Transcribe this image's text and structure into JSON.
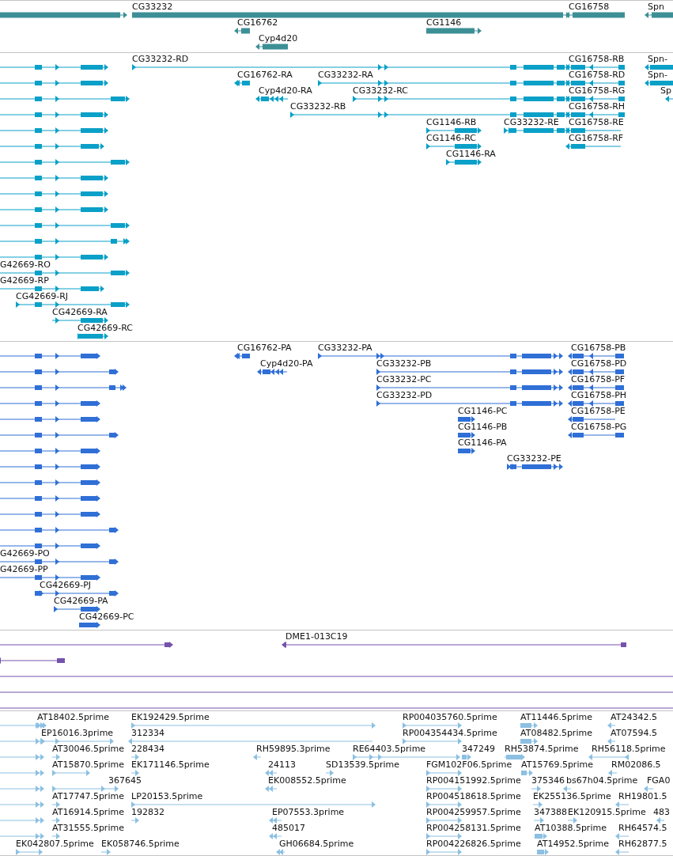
{
  "tracks": [
    {
      "kind": "gene",
      "features": [
        {
          "label": "CG33232"
        },
        {
          "label": "CG16758"
        },
        {
          "label": "Spn"
        },
        {
          "label": "CG16762"
        },
        {
          "label": "CG1146"
        },
        {
          "label": "Cyp4d20"
        }
      ]
    },
    {
      "kind": "transcript",
      "features": [
        {
          "label": "CG33232-RD"
        },
        {
          "label": "CG16758-RB"
        },
        {
          "label": "Spn-"
        },
        {
          "label": "CG16762-RA"
        },
        {
          "label": "CG33232-RA"
        },
        {
          "label": "CG16758-RD"
        },
        {
          "label": "Spn-"
        },
        {
          "label": "Cyp4d20-RA"
        },
        {
          "label": "CG33232-RC"
        },
        {
          "label": "CG16758-RG"
        },
        {
          "label": "Sp"
        },
        {
          "label": "CG33232-RB"
        },
        {
          "label": "CG16758-RH"
        },
        {
          "label": "CG1146-RB"
        },
        {
          "label": "CG33232-RE"
        },
        {
          "label": "CG16758-RE"
        },
        {
          "label": "CG1146-RC"
        },
        {
          "label": "CG16758-RF"
        },
        {
          "label": "CG1146-RA"
        },
        {
          "label": "G42669-RO"
        },
        {
          "label": "G42669-RP"
        },
        {
          "label": "CG42669-RJ"
        },
        {
          "label": "CG42669-RA"
        },
        {
          "label": "CG42669-RC"
        }
      ]
    },
    {
      "kind": "protein",
      "features": [
        {
          "label": "CG16762-PA"
        },
        {
          "label": "CG33232-PA"
        },
        {
          "label": "CG16758-PB"
        },
        {
          "label": "Cyp4d20-PA"
        },
        {
          "label": "CG33232-PB"
        },
        {
          "label": "CG16758-PD"
        },
        {
          "label": "CG33232-PC"
        },
        {
          "label": "CG16758-PF"
        },
        {
          "label": "CG33232-PD"
        },
        {
          "label": "CG16758-PH"
        },
        {
          "label": "CG1146-PC"
        },
        {
          "label": "CG16758-PE"
        },
        {
          "label": "CG1146-PB"
        },
        {
          "label": "CG16758-PG"
        },
        {
          "label": "CG1146-PA"
        },
        {
          "label": "CG33232-PE"
        },
        {
          "label": "G42669-PO"
        },
        {
          "label": "G42669-PP"
        },
        {
          "label": "CG42669-PJ"
        },
        {
          "label": "CG42669-PA"
        },
        {
          "label": "CG42669-PC"
        }
      ]
    },
    {
      "kind": "clone",
      "features": [
        {
          "label": "DME1-013C19"
        }
      ]
    },
    {
      "kind": "est",
      "features": [
        {
          "label": "AT18402.5prime"
        },
        {
          "label": "EK192429.5prime"
        },
        {
          "label": "RP004035760.5prime"
        },
        {
          "label": "AT11446.5prime"
        },
        {
          "label": "AT24342.5"
        },
        {
          "label": "EP16016.3prime"
        },
        {
          "label": "312334"
        },
        {
          "label": "RP004354434.5prime"
        },
        {
          "label": "AT08482.5prime"
        },
        {
          "label": "AT07594.5"
        },
        {
          "label": "AT30046.5prime"
        },
        {
          "label": "228434"
        },
        {
          "label": "RH59895.3prime"
        },
        {
          "label": "RE64403.5prime"
        },
        {
          "label": "347249"
        },
        {
          "label": "RH53874.5prime"
        },
        {
          "label": "RH56118.5prime"
        },
        {
          "label": "AT15870.5prime"
        },
        {
          "label": "EK171146.5prime"
        },
        {
          "label": "24113"
        },
        {
          "label": "SD13539.5prime"
        },
        {
          "label": "FGM102F06.5prime"
        },
        {
          "label": "AT15769.5prime"
        },
        {
          "label": "RM02086.5"
        },
        {
          "label": "367645"
        },
        {
          "label": "EK008552.5prime"
        },
        {
          "label": "RP004151992.5prime"
        },
        {
          "label": "375346"
        },
        {
          "label": "bs67h04.5prime"
        },
        {
          "label": "FGA0"
        },
        {
          "label": "AT17747.5prime"
        },
        {
          "label": "LP20153.5prime"
        },
        {
          "label": "RP004518618.5prime"
        },
        {
          "label": "EK255136.5prime"
        },
        {
          "label": "RH19801.5"
        },
        {
          "label": "AT16914.5prime"
        },
        {
          "label": "192832"
        },
        {
          "label": "EP07553.3prime"
        },
        {
          "label": "RP004259957.5prime"
        },
        {
          "label": "347388"
        },
        {
          "label": "EK120915.5prime"
        },
        {
          "label": "483"
        },
        {
          "label": "AT31555.5prime"
        },
        {
          "label": "485017"
        },
        {
          "label": "RP004258131.5prime"
        },
        {
          "label": "AT10388.5prime"
        },
        {
          "label": "RH64574.5"
        },
        {
          "label": "EK042807.5prime"
        },
        {
          "label": "EK058746.5prime"
        },
        {
          "label": "GH06684.5prime"
        },
        {
          "label": "RP004226826.5prime"
        },
        {
          "label": "AT14952.5prime"
        },
        {
          "label": "RH62877.5"
        }
      ]
    }
  ]
}
